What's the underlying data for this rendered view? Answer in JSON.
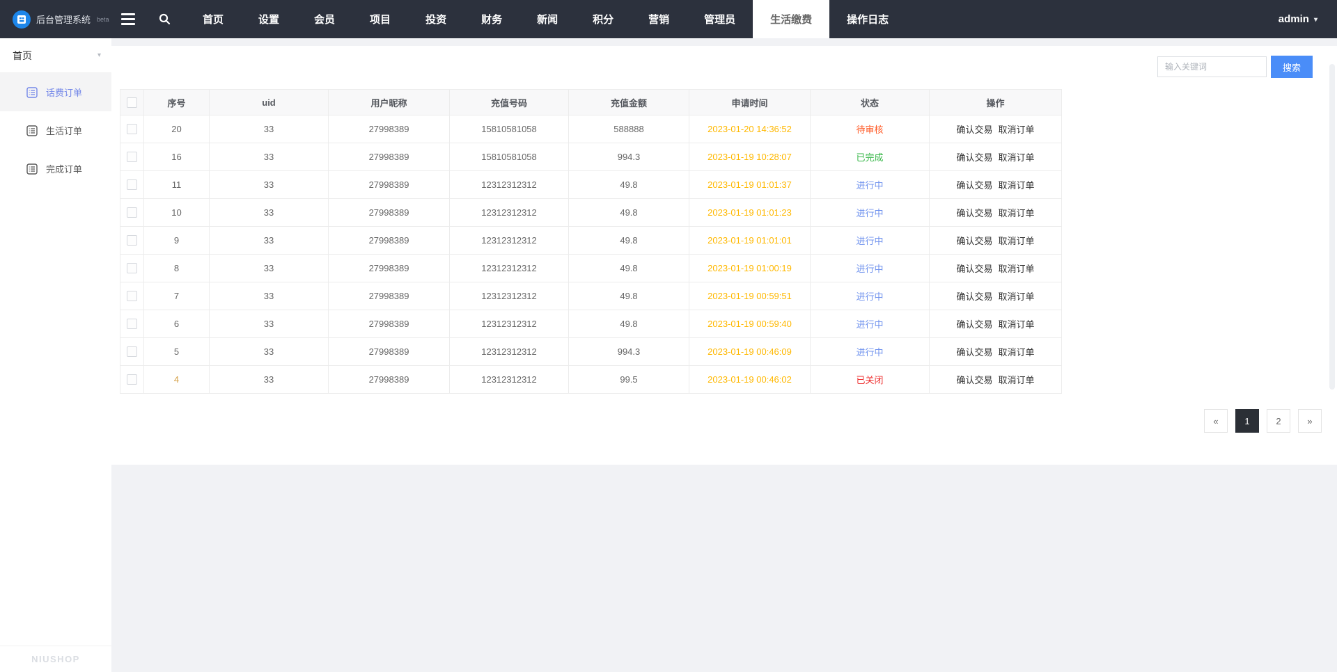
{
  "navbar": {
    "brand": {
      "title": "后台管理系统",
      "badge": "beta"
    },
    "items": [
      {
        "label": "首页"
      },
      {
        "label": "设置"
      },
      {
        "label": "会员"
      },
      {
        "label": "项目"
      },
      {
        "label": "投资"
      },
      {
        "label": "财务"
      },
      {
        "label": "新闻"
      },
      {
        "label": "积分"
      },
      {
        "label": "营销"
      },
      {
        "label": "管理员"
      },
      {
        "label": "生活缴费",
        "active": true
      },
      {
        "label": "操作日志"
      }
    ],
    "user": "admin",
    "user_caret": "▾"
  },
  "sidebar": {
    "section_label": "首页",
    "section_caret": "▾",
    "items": [
      {
        "label": "话费订单",
        "active": true
      },
      {
        "label": "生活订单"
      },
      {
        "label": "完成订单"
      }
    ],
    "watermark": "NIUSHOP"
  },
  "search": {
    "placeholder": "输入关键词",
    "button_label": "搜索"
  },
  "table": {
    "headers": [
      "序号",
      "uid",
      "用户昵称",
      "充值号码",
      "充值金额",
      "申请时间",
      "状态",
      "操作"
    ],
    "action_labels": [
      "确认交易",
      "取消订单"
    ],
    "rows": [
      {
        "no": "20",
        "uid": "33",
        "nickname": "27998389",
        "number": "15810581058",
        "amount": "588888",
        "time": "2023-01-20 14:36:52",
        "status": "待审核"
      },
      {
        "no": "16",
        "uid": "33",
        "nickname": "27998389",
        "number": "15810581058",
        "amount": "994.3",
        "time": "2023-01-19 10:28:07",
        "status": "已完成"
      },
      {
        "no": "11",
        "uid": "33",
        "nickname": "27998389",
        "number": "12312312312",
        "amount": "49.8",
        "time": "2023-01-19 01:01:37",
        "status": "进行中"
      },
      {
        "no": "10",
        "uid": "33",
        "nickname": "27998389",
        "number": "12312312312",
        "amount": "49.8",
        "time": "2023-01-19 01:01:23",
        "status": "进行中"
      },
      {
        "no": "9",
        "uid": "33",
        "nickname": "27998389",
        "number": "12312312312",
        "amount": "49.8",
        "time": "2023-01-19 01:01:01",
        "status": "进行中"
      },
      {
        "no": "8",
        "uid": "33",
        "nickname": "27998389",
        "number": "12312312312",
        "amount": "49.8",
        "time": "2023-01-19 01:00:19",
        "status": "进行中"
      },
      {
        "no": "7",
        "uid": "33",
        "nickname": "27998389",
        "number": "12312312312",
        "amount": "49.8",
        "time": "2023-01-19 00:59:51",
        "status": "进行中"
      },
      {
        "no": "6",
        "uid": "33",
        "nickname": "27998389",
        "number": "12312312312",
        "amount": "49.8",
        "time": "2023-01-19 00:59:40",
        "status": "进行中"
      },
      {
        "no": "5",
        "uid": "33",
        "nickname": "27998389",
        "number": "12312312312",
        "amount": "994.3",
        "time": "2023-01-19 00:46:09",
        "status": "进行中"
      },
      {
        "no": "4",
        "uid": "33",
        "nickname": "27998389",
        "number": "12312312312",
        "amount": "99.5",
        "time": "2023-01-19 00:46:02",
        "status": "已关闭",
        "no_color": "#d5a147"
      }
    ]
  },
  "pagination": {
    "prev": "«",
    "pages": [
      "1",
      "2"
    ],
    "active_page": "1",
    "next": "»"
  },
  "colors": {
    "navbar_bg": "#2c313d",
    "accent_blue": "#4a8df8",
    "sidebar_active_blue": "#7387e8",
    "time_orange": "#ffb800",
    "pagination_active_bg": "#2b2f36",
    "status": {
      "待审核": "#ff5722",
      "已完成": "#33b544",
      "进行中": "#6f92ee",
      "已关闭": "#ee2f2f"
    }
  }
}
